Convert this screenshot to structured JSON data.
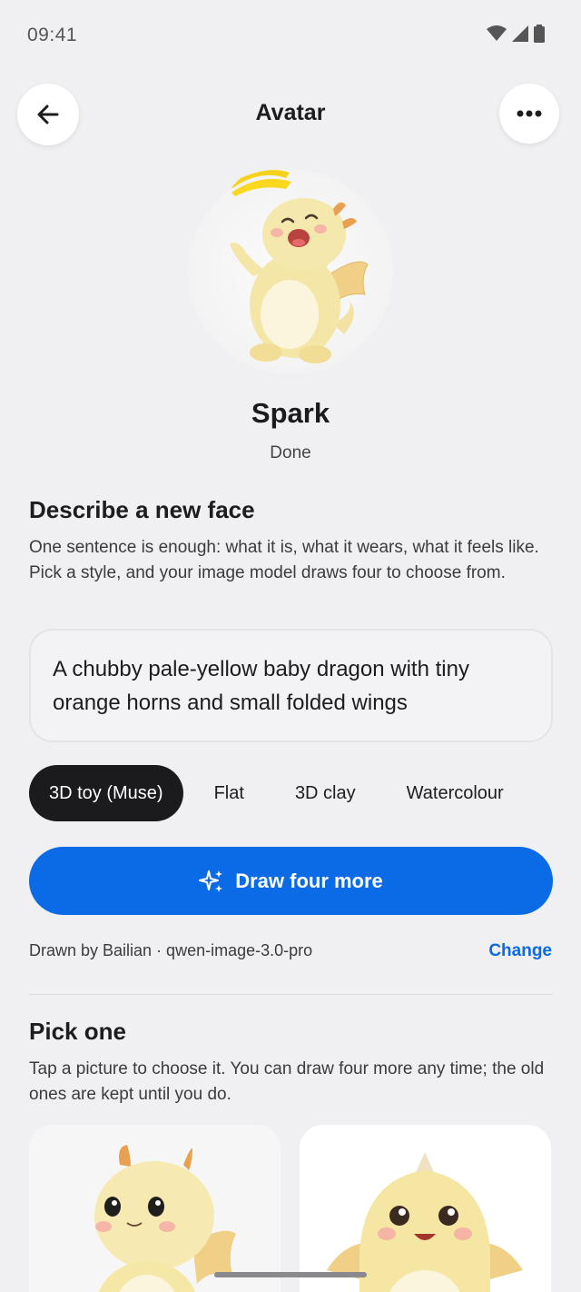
{
  "status": {
    "time": "09:41"
  },
  "header": {
    "title": "Avatar"
  },
  "avatar": {
    "name": "Spark",
    "status": "Done"
  },
  "describe": {
    "title": "Describe a new face",
    "description": "One sentence is enough: what it is, what it wears, what it feels like. Pick a style, and your image model draws four to choose from.",
    "prompt_value": "A chubby pale-yellow baby dragon with tiny orange horns and small folded wings"
  },
  "styles": [
    {
      "label": "3D toy (Muse)",
      "selected": true
    },
    {
      "label": "Flat",
      "selected": false
    },
    {
      "label": "3D clay",
      "selected": false
    },
    {
      "label": "Watercolour",
      "selected": false
    }
  ],
  "action": {
    "label": "Draw four more"
  },
  "model": {
    "text": "Drawn by Bailian · qwen-image-3.0-pro",
    "change_label": "Change"
  },
  "pick": {
    "title": "Pick one",
    "description": "Tap a picture to choose it. You can draw four more any time; the old ones are kept until you do."
  },
  "colors": {
    "accent": "#0b6ae6",
    "chip_active": "#1b1b1d",
    "background": "#f0f0f2"
  }
}
